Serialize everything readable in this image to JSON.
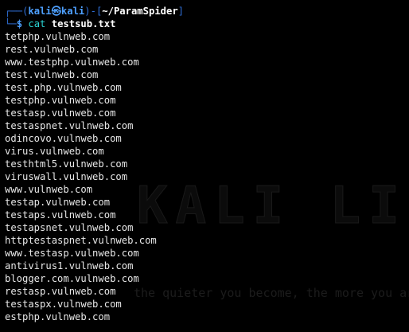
{
  "prompt": {
    "frame_left": "┌──(",
    "user": "kali",
    "at_symbol": "㉿",
    "host": "kali",
    "frame_mid": ")-[",
    "path": "~/ParamSpider",
    "frame_right": "]",
    "frame_bottom": "└─",
    "dollar": "$",
    "command": "cat",
    "argument": "testsub.txt"
  },
  "output_lines": [
    "tetphp.vulnweb.com",
    "rest.vulnweb.com",
    "www.testphp.vulnweb.com",
    "test.vulnweb.com",
    "test.php.vulnweb.com",
    "testphp.vulnweb.com",
    "testasp.vulnweb.com",
    "testaspnet.vulnweb.com",
    "odincovo.vulnweb.com",
    "virus.vulnweb.com",
    "testhtml5.vulnweb.com",
    "viruswall.vulnweb.com",
    "www.vulnweb.com",
    "testap.vulnweb.com",
    "testaps.vulnweb.com",
    "testapsnet.vulnweb.com",
    "httptestaspnet.vulnweb.com",
    "www.testasp.vulnweb.com",
    "antivirus1.vulnweb.com",
    "blogger.com.vulnweb.com",
    "restasp.vulnweb.com",
    "testaspx.vulnweb.com",
    "estphp.vulnweb.com"
  ],
  "wallpaper": {
    "logo_text": "KALI LINUX",
    "tagline": "the quieter you become, the more you are able to hear"
  },
  "colors": {
    "background": "#000000",
    "frame": "#2f6fd6",
    "user_host": "#4ea0ff",
    "command": "#2bd4d4",
    "text": "#e8e8e8"
  }
}
